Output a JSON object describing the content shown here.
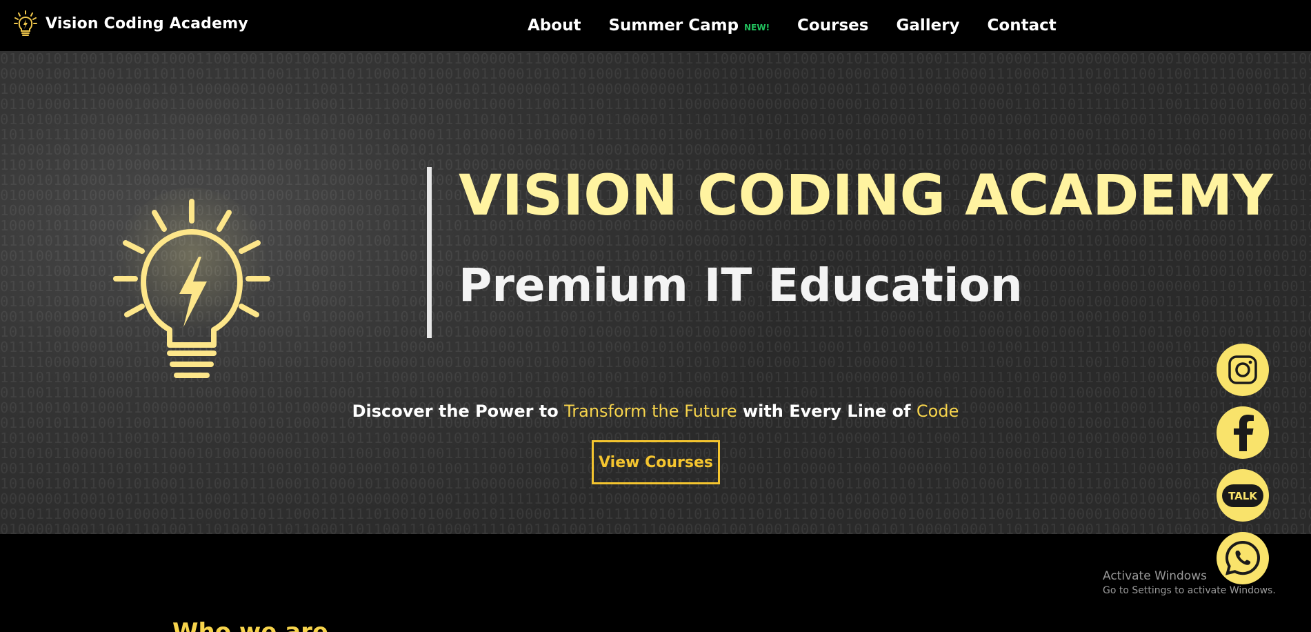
{
  "brand": {
    "name": "Vision Coding Academy",
    "icon": "lightbulb-icon"
  },
  "nav": {
    "about": "About",
    "summer_camp": "Summer Camp",
    "summer_camp_badge": "NEW!",
    "courses": "Courses",
    "gallery": "Gallery",
    "contact": "Contact"
  },
  "hero": {
    "title": "VISION CODING ACADEMY",
    "subtitle": "Premium IT Education",
    "tagline": {
      "part1": "Discover the Power to ",
      "highlight1": "Transform the Future",
      "part2": " with Every Line of ",
      "highlight2": "Code"
    },
    "cta_label": "View Courses"
  },
  "social": [
    {
      "name": "instagram-icon"
    },
    {
      "name": "facebook-icon"
    },
    {
      "name": "kakaotalk-icon",
      "label": "TALK"
    },
    {
      "name": "whatsapp-icon"
    }
  ],
  "watermark": {
    "title": "Activate Windows",
    "subtitle": "Go to Settings to activate Windows."
  },
  "section": {
    "heading": "Who we are"
  },
  "colors": {
    "accent": "#f5c52f",
    "hero_title": "#fff3a0",
    "badge_green": "#22c35e",
    "social_bg": "#f9e36b"
  }
}
